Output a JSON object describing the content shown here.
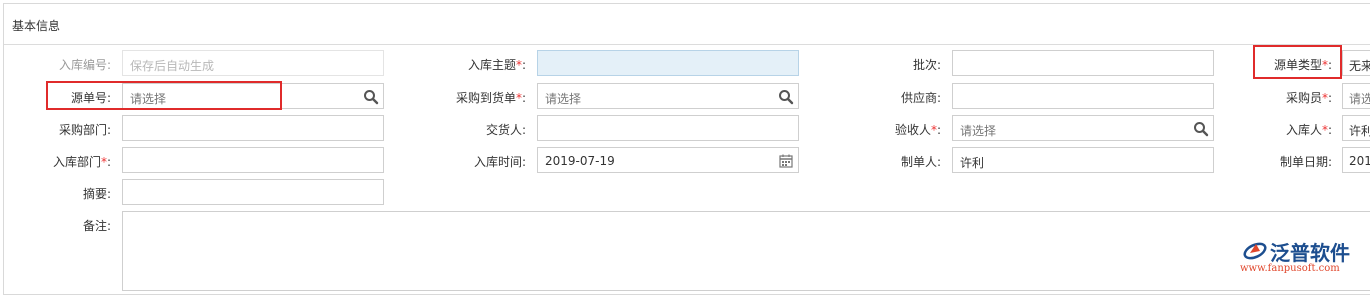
{
  "section_title": "基本信息",
  "fields": {
    "inbound_no": {
      "label": "入库编号:",
      "value": "保存后自动生成"
    },
    "inbound_subject": {
      "label": "入库主题",
      "required": "*",
      "colon": ":",
      "value": ""
    },
    "batch": {
      "label": "批次:",
      "value": ""
    },
    "source_doc_type": {
      "label": "源单类型",
      "required": "*",
      "colon": ":",
      "value": "无来"
    },
    "source_doc_no": {
      "label": "源单号:",
      "placeholder": "请选择"
    },
    "purchase_receipt": {
      "label": "采购到货单",
      "required": "*",
      "colon": ":",
      "placeholder": "请选择"
    },
    "supplier": {
      "label": "供应商:",
      "value": ""
    },
    "purchaser": {
      "label": "采购员",
      "required": "*",
      "colon": ":",
      "value": "请选"
    },
    "purchase_dept": {
      "label": "采购部门:",
      "value": ""
    },
    "deliverer": {
      "label": "交货人:",
      "value": ""
    },
    "inspector": {
      "label": "验收人",
      "required": "*",
      "colon": ":",
      "placeholder": "请选择"
    },
    "receiver": {
      "label": "入库人",
      "required": "*",
      "colon": ":",
      "value": "许利"
    },
    "inbound_dept": {
      "label": "入库部门",
      "required": "*",
      "colon": ":",
      "value": ""
    },
    "inbound_time": {
      "label": "入库时间:",
      "value": "2019-07-19"
    },
    "creator": {
      "label": "制单人:",
      "value": "许利"
    },
    "create_date": {
      "label": "制单日期:",
      "value": "201"
    },
    "summary": {
      "label": "摘要:",
      "value": ""
    },
    "remarks": {
      "label": "备注:",
      "value": ""
    }
  },
  "watermark": {
    "brand": "泛普软件",
    "url": "www.fanpusoft.com"
  },
  "colors": {
    "highlight": "#e02b2b",
    "required": "#e33",
    "focus_bg": "#e4f0f8",
    "logo_blue": "#1d4e8f",
    "logo_red": "#e0472c"
  }
}
